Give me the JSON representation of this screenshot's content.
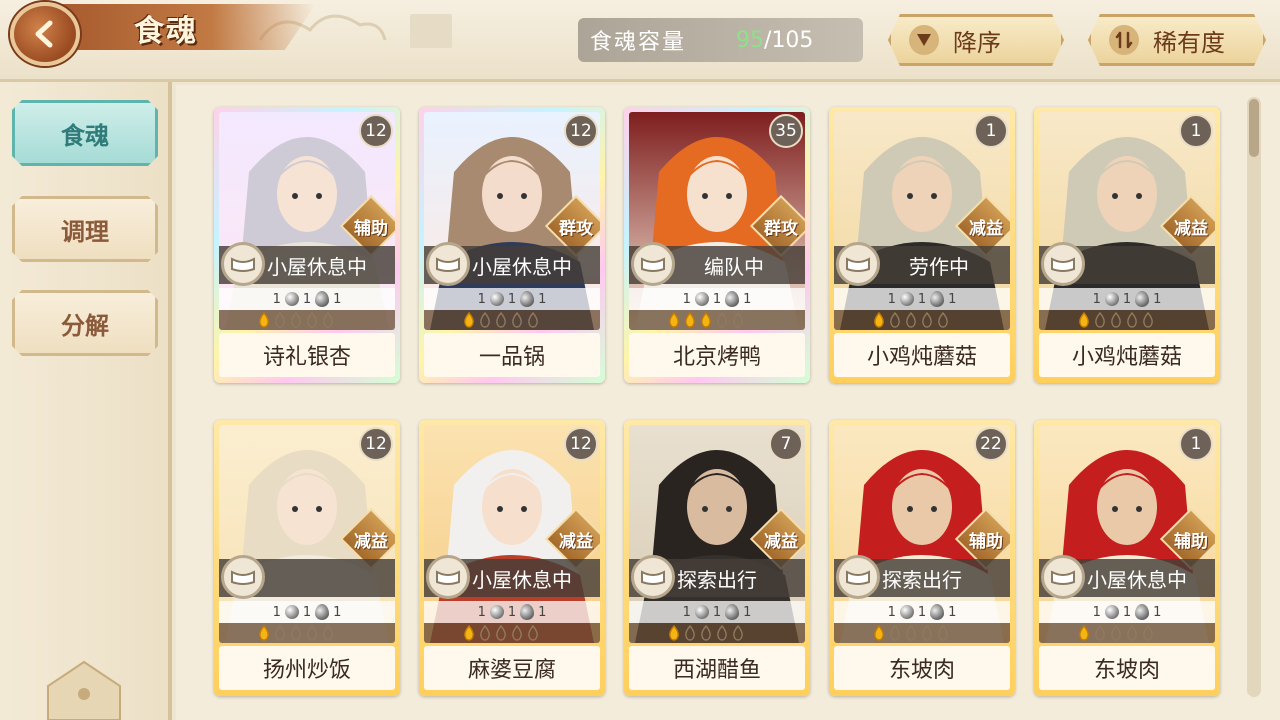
{
  "header": {
    "title": "食魂",
    "capacity_label": "食魂容量",
    "capacity_current": "95",
    "capacity_separator": "/",
    "capacity_max": "105",
    "sort_order_label": "降序",
    "sort_key_label": "稀有度"
  },
  "sidebar": {
    "items": [
      {
        "label": "食魂",
        "active": true
      },
      {
        "label": "调理",
        "active": false
      },
      {
        "label": "分解",
        "active": false
      }
    ]
  },
  "colors": {
    "accent_teal": "#5fb5ae",
    "capacity_green": "#8fe08a",
    "brand_brown": "#a75a2e"
  },
  "cards": [
    {
      "name": "诗礼银杏",
      "level": "12",
      "role": "辅助",
      "status": "小屋休息中",
      "frame": "rainbow",
      "stats": [
        "1",
        "1",
        "1"
      ],
      "fires": 1,
      "theme": "silver"
    },
    {
      "name": "一品锅",
      "level": "12",
      "role": "群攻",
      "status": "小屋休息中",
      "frame": "rainbow",
      "stats": [
        "1",
        "1",
        "1"
      ],
      "fires": 1,
      "theme": "brown"
    },
    {
      "name": "北京烤鸭",
      "level": "35",
      "role": "群攻",
      "status": "编队中",
      "frame": "rainbow",
      "stats": [
        "1",
        "1",
        "1"
      ],
      "fires": 3,
      "theme": "orange"
    },
    {
      "name": "小鸡炖蘑菇",
      "level": "1",
      "role": "减益",
      "status": "劳作中",
      "frame": "gold",
      "stats": [
        "1",
        "1",
        "1"
      ],
      "fires": 1,
      "theme": "dark"
    },
    {
      "name": "小鸡炖蘑菇",
      "level": "1",
      "role": "减益",
      "status": "",
      "frame": "gold",
      "stats": [
        "1",
        "1",
        "1"
      ],
      "fires": 1,
      "theme": "dark"
    },
    {
      "name": "扬州炒饭",
      "level": "12",
      "role": "减益",
      "status": "",
      "frame": "gold",
      "stats": [
        "1",
        "1",
        "1"
      ],
      "fires": 1,
      "theme": "cream"
    },
    {
      "name": "麻婆豆腐",
      "level": "12",
      "role": "减益",
      "status": "小屋休息中",
      "frame": "gold",
      "stats": [
        "1",
        "1",
        "1"
      ],
      "fires": 1,
      "theme": "red"
    },
    {
      "name": "西湖醋鱼",
      "level": "7",
      "role": "减益",
      "status": "探索出行",
      "frame": "gold",
      "stats": [
        "1",
        "1",
        "1"
      ],
      "fires": 1,
      "theme": "black"
    },
    {
      "name": "东坡肉",
      "level": "22",
      "role": "辅助",
      "status": "探索出行",
      "frame": "gold",
      "stats": [
        "1",
        "1",
        "1"
      ],
      "fires": 1,
      "theme": "crimson"
    },
    {
      "name": "东坡肉",
      "level": "1",
      "role": "辅助",
      "status": "小屋休息中",
      "frame": "gold",
      "stats": [
        "1",
        "1",
        "1"
      ],
      "fires": 1,
      "theme": "crimson"
    }
  ],
  "icons": {
    "back": "chevron-left-icon",
    "sort_order": "triangle-down-icon",
    "sort_key": "swap-vertical-icon",
    "status": "bed-icon",
    "stat": "orb-icon",
    "fire": "flame-icon"
  }
}
